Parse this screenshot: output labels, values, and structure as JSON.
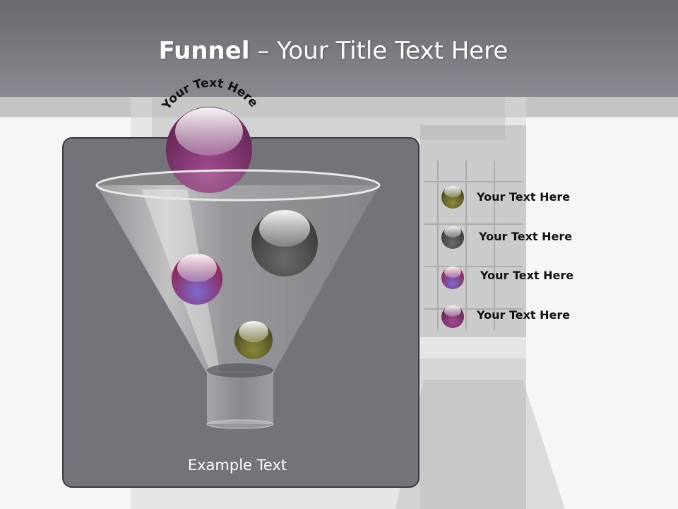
{
  "slide": {
    "title_bold": "Funnel",
    "title_rest": " – Your Title Text Here",
    "arc_text": "Your Text Here",
    "example_text": "Example Text"
  },
  "legend": [
    {
      "label": "Your  Text Here",
      "color": "#6b6b2e"
    },
    {
      "label": "Your  Text Here",
      "color": "#5a5a5a"
    },
    {
      "label": "Your  Text Here",
      "color": "#6a55b0"
    },
    {
      "label": "Your  Text Here",
      "color": "#6a2a5c"
    }
  ],
  "colors": {
    "header": "#7a7980",
    "panel": "#747379",
    "sphere_top": "#7a2d6a",
    "sphere_gray": "#505050",
    "sphere_violet": "#6a55b0",
    "sphere_olive": "#6b6b2e"
  }
}
